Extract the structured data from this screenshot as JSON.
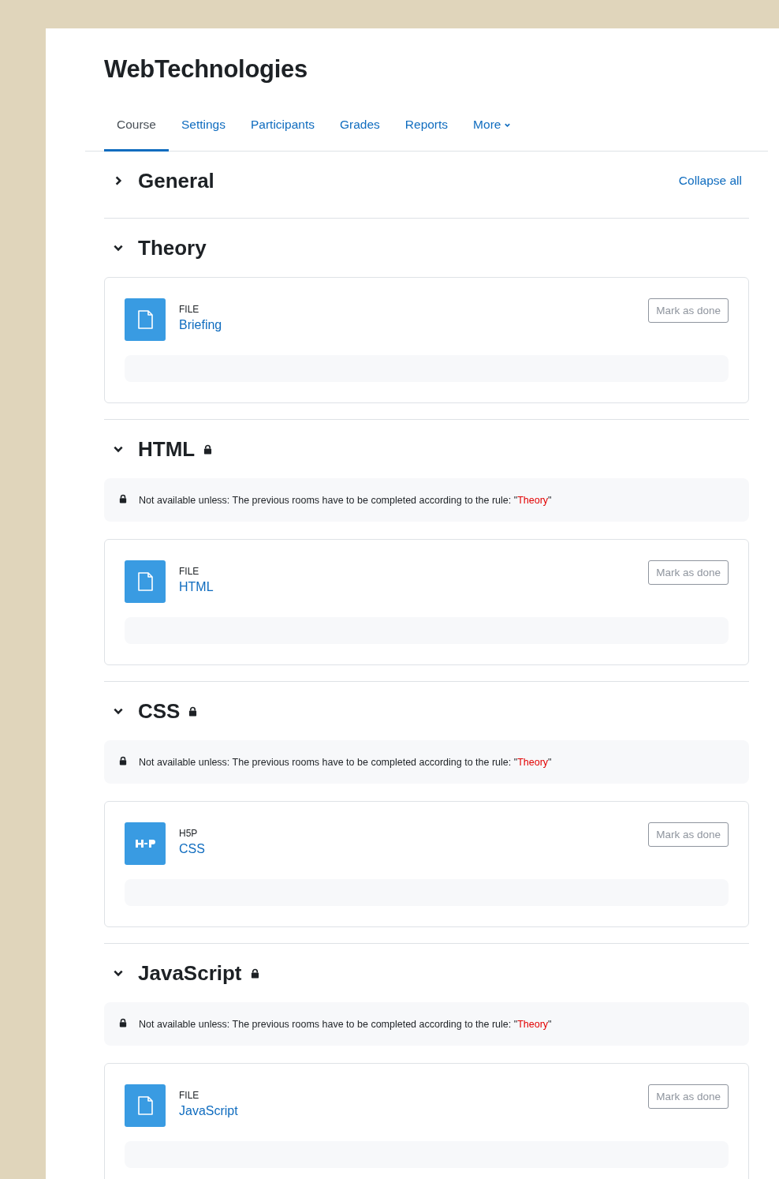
{
  "course_title": "WebTechnologies",
  "tabs": [
    {
      "label": "Course",
      "selected": true
    },
    {
      "label": "Settings",
      "selected": false
    },
    {
      "label": "Participants",
      "selected": false
    },
    {
      "label": "Grades",
      "selected": false
    },
    {
      "label": "Reports",
      "selected": false
    },
    {
      "label": "More",
      "selected": false,
      "dropdown": true
    }
  ],
  "collapse_all": "Collapse all",
  "sections": [
    {
      "title": "General",
      "expanded": false,
      "locked": false
    },
    {
      "title": "Theory",
      "expanded": true,
      "locked": false,
      "activities": [
        {
          "kind": "file",
          "type": "FILE",
          "name": "Briefing",
          "button": "Mark as done"
        }
      ]
    },
    {
      "title": "HTML",
      "expanded": true,
      "locked": true,
      "restriction": {
        "text": "Not available unless: The previous rooms have to be completed according to the rule: \"",
        "rule": "Theory",
        "end": "\""
      },
      "activities": [
        {
          "kind": "file",
          "type": "FILE",
          "name": "HTML",
          "button": "Mark as done"
        }
      ]
    },
    {
      "title": "CSS",
      "expanded": true,
      "locked": true,
      "restriction": {
        "text": "Not available unless: The previous rooms have to be completed according to the rule: \"",
        "rule": "Theory",
        "end": "\""
      },
      "activities": [
        {
          "kind": "h5p",
          "type": "H5P",
          "name": "CSS",
          "button": "Mark as done"
        }
      ]
    },
    {
      "title": "JavaScript",
      "expanded": true,
      "locked": true,
      "restriction": {
        "text": "Not available unless: The previous rooms have to be completed according to the rule: \"",
        "rule": "Theory",
        "end": "\""
      },
      "activities": [
        {
          "kind": "file",
          "type": "FILE",
          "name": "JavaScript",
          "button": "Mark as done"
        }
      ]
    }
  ]
}
